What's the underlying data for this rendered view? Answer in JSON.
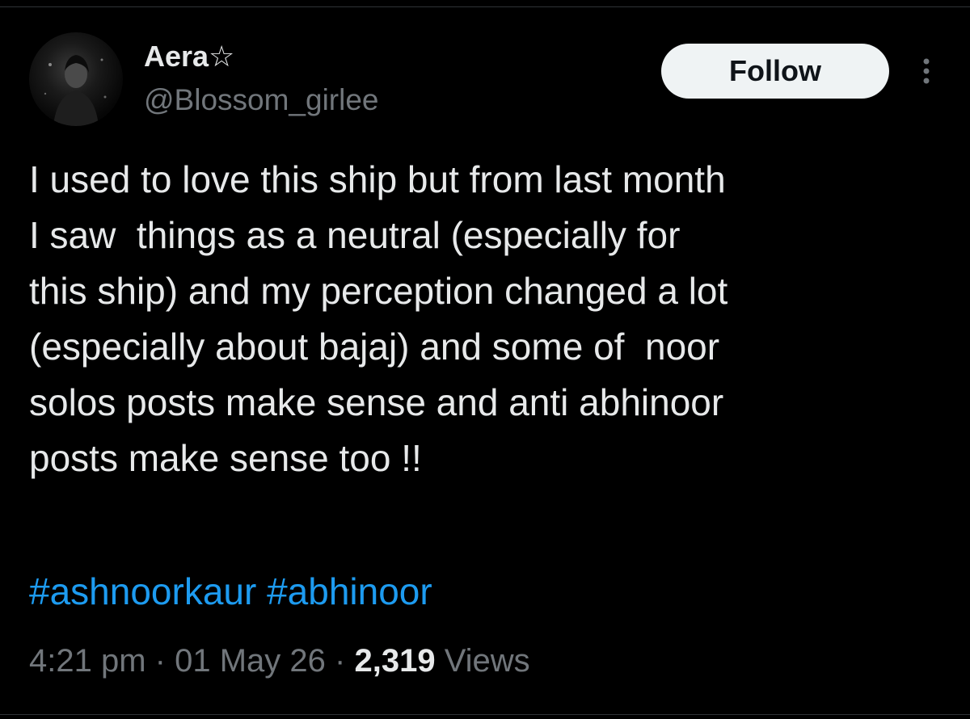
{
  "author": {
    "display_name": "Aera☆",
    "handle": "@Blossom_girlee"
  },
  "actions": {
    "follow_label": "Follow"
  },
  "tweet": {
    "lines": [
      "I used to love this ship but from last month",
      "I saw  things as a neutral (especially for",
      "this ship) and my perception changed a lot",
      "(especially about bajaj) and some of  noor",
      "solos posts make sense and anti abhinoor",
      "posts make sense too !!"
    ],
    "hashtags": [
      "#ashnoorkaur",
      "#abhinoor"
    ]
  },
  "meta": {
    "time": "4:21 pm",
    "separator": "·",
    "date": "01 May 26",
    "views_count": "2,319",
    "views_label": "Views"
  },
  "colors": {
    "background": "#000000",
    "text": "#e7e9ea",
    "secondary": "#71767b",
    "link": "#1d9bf0",
    "button_bg": "#eff3f4"
  },
  "icons": {
    "more": "more-vertical-icon"
  }
}
